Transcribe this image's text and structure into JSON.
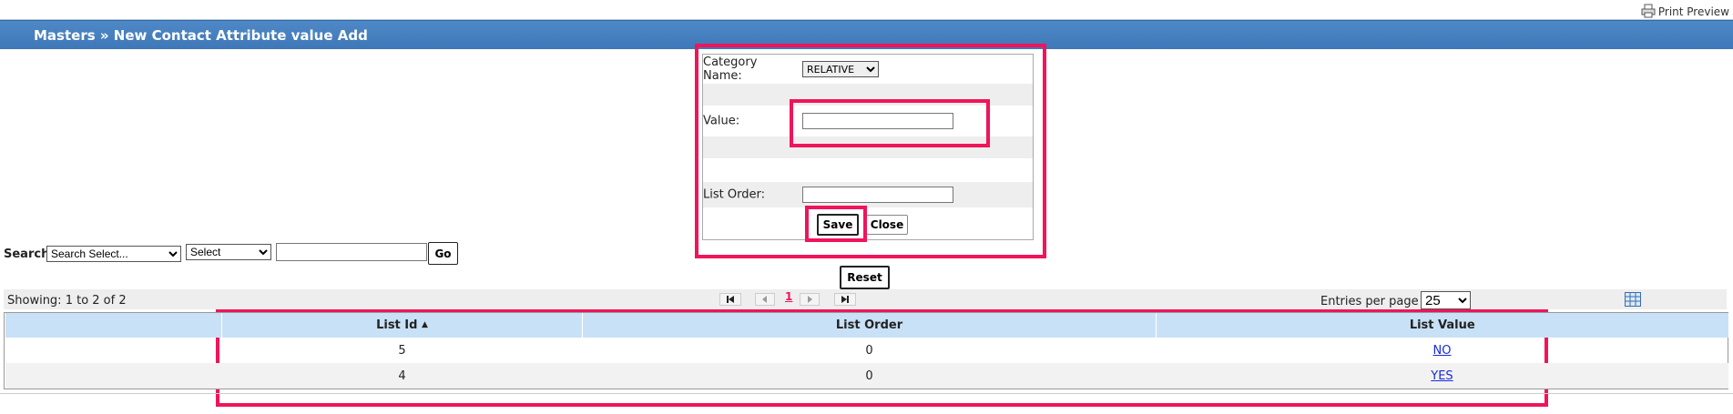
{
  "header": {
    "print_preview": "Print Preview",
    "title": "Masters » New Contact Attribute value Add"
  },
  "form": {
    "category_label": "Category Name:",
    "category_value": "RELATIVE",
    "value_label": "Value:",
    "value_input": "",
    "list_order_label": "List Order:",
    "list_order_input": "",
    "save_label": "Save",
    "close_label": "Close"
  },
  "search": {
    "label": "Search",
    "field_select": "Search Select...",
    "operator_select": "Select",
    "query": "",
    "go_label": "Go",
    "reset_label": "Reset"
  },
  "pager": {
    "showing": "Showing: 1 to 2 of 2",
    "current_page": "1",
    "entries_label": "Entries per page",
    "entries_value": "25"
  },
  "table": {
    "columns": [
      "List Id",
      "List Order",
      "List Value"
    ],
    "sort_indicator": "▲",
    "rows": [
      {
        "id": "5",
        "order": "0",
        "value": "NO"
      },
      {
        "id": "4",
        "order": "0",
        "value": "YES"
      }
    ]
  },
  "icons": [
    "printer-icon",
    "first-page-icon",
    "prev-page-icon",
    "next-page-icon",
    "last-page-icon",
    "column-chooser-icon",
    "sort-asc-icon"
  ],
  "colors": {
    "title_bar": "#4682c0",
    "header_row": "#c9e1f6",
    "highlight": "#f0145a",
    "link": "#1a2bd8"
  }
}
